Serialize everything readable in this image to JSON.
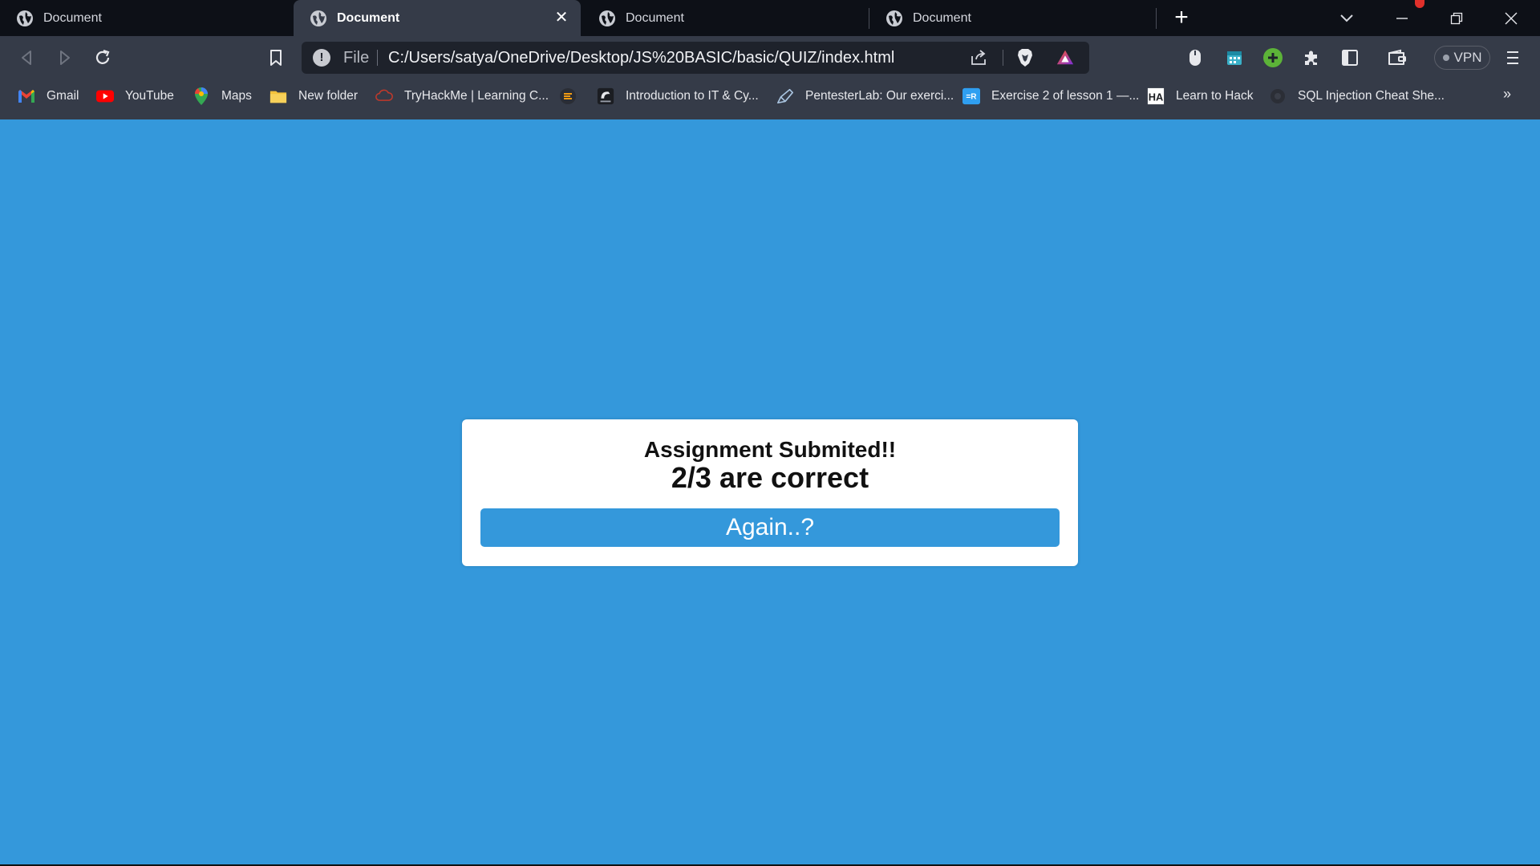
{
  "tabs": [
    {
      "title": "Document",
      "active": false
    },
    {
      "title": "Document",
      "active": true
    },
    {
      "title": "Document",
      "active": false
    },
    {
      "title": "Document",
      "active": false
    }
  ],
  "omnibox": {
    "scheme_label": "File",
    "url": "C:/Users/satya/OneDrive/Desktop/JS%20BASIC/basic/QUIZ/index.html"
  },
  "toolbar": {
    "vpn_label": "VPN"
  },
  "bookmarks": [
    {
      "label": "Gmail",
      "icon": "gmail-icon"
    },
    {
      "label": "YouTube",
      "icon": "youtube-icon"
    },
    {
      "label": "Maps",
      "icon": "maps-icon"
    },
    {
      "label": "New folder",
      "icon": "folder-icon"
    },
    {
      "label": "TryHackMe | Learning C...",
      "icon": "tryhackme-icon"
    },
    {
      "label": "",
      "icon": "site-icon"
    },
    {
      "label": "Introduction to IT & Cy...",
      "icon": "cybrary-icon"
    },
    {
      "label": "PentesterLab: Our exerci...",
      "icon": "pentesterlab-icon"
    },
    {
      "label": "Exercise 2 of lesson 1 —...",
      "icon": "exercise-icon"
    },
    {
      "label": "Learn to Hack",
      "icon": "hackaday-icon"
    },
    {
      "label": "SQL Injection Cheat She...",
      "icon": "sql-icon"
    }
  ],
  "quiz": {
    "title": "Assignment Submited!!",
    "score": "2/3 are correct",
    "again_label": "Again..?"
  },
  "colors": {
    "page_background": "#3498db",
    "button_background": "#3498db",
    "card_background": "#ffffff"
  }
}
